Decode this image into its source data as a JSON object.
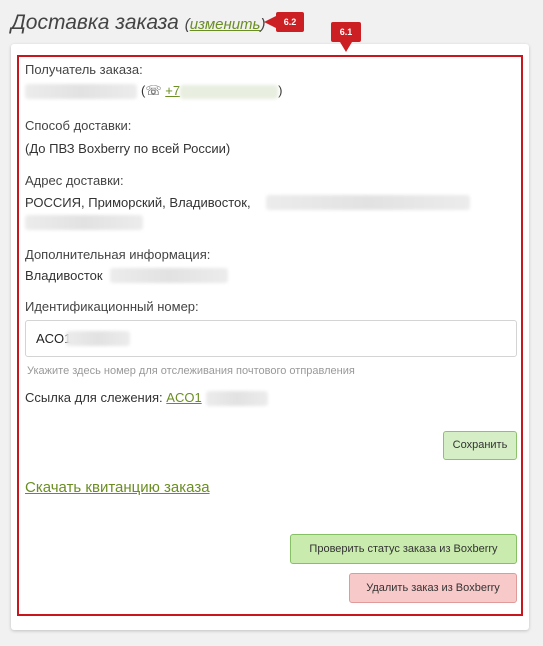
{
  "header": {
    "title": "Доставка заказа",
    "change_link": "изменить"
  },
  "callouts": {
    "top": "6.2",
    "frame": "6.1"
  },
  "recipient": {
    "label": "Получатель заказа:",
    "phone_icon": "☏",
    "phone_prefix": "+7",
    "open_paren": "(",
    "close_paren": ")"
  },
  "delivery_method": {
    "label": "Способ доставки:",
    "value": "(До ПВЗ Boxberry по всей России)"
  },
  "address": {
    "label": "Адрес доставки:",
    "value": "РОССИЯ, Приморский, Владивосток,"
  },
  "extra_info": {
    "label": "Дополнительная информация:",
    "value": "Владивосток"
  },
  "tracking": {
    "id_label": "Идентификационный номер:",
    "id_value": "ACO1",
    "hint": "Укажите здесь номер для отслеживания почтового отправления",
    "link_label": "Ссылка для слежения:",
    "link_value": "ACO1"
  },
  "buttons": {
    "save": "Сохранить",
    "check_status": "Проверить статус заказа из Boxberry",
    "delete": "Удалить заказ из Boxberry"
  },
  "receipt_link": "Скачать квитанцию заказа",
  "colors": {
    "frame": "#c8161d",
    "link": "#6b8e23",
    "save_bg": "#d5eec5",
    "check_bg": "#c9ebae",
    "delete_bg": "#f8c9c9"
  },
  "icons": [
    "phone-icon"
  ]
}
